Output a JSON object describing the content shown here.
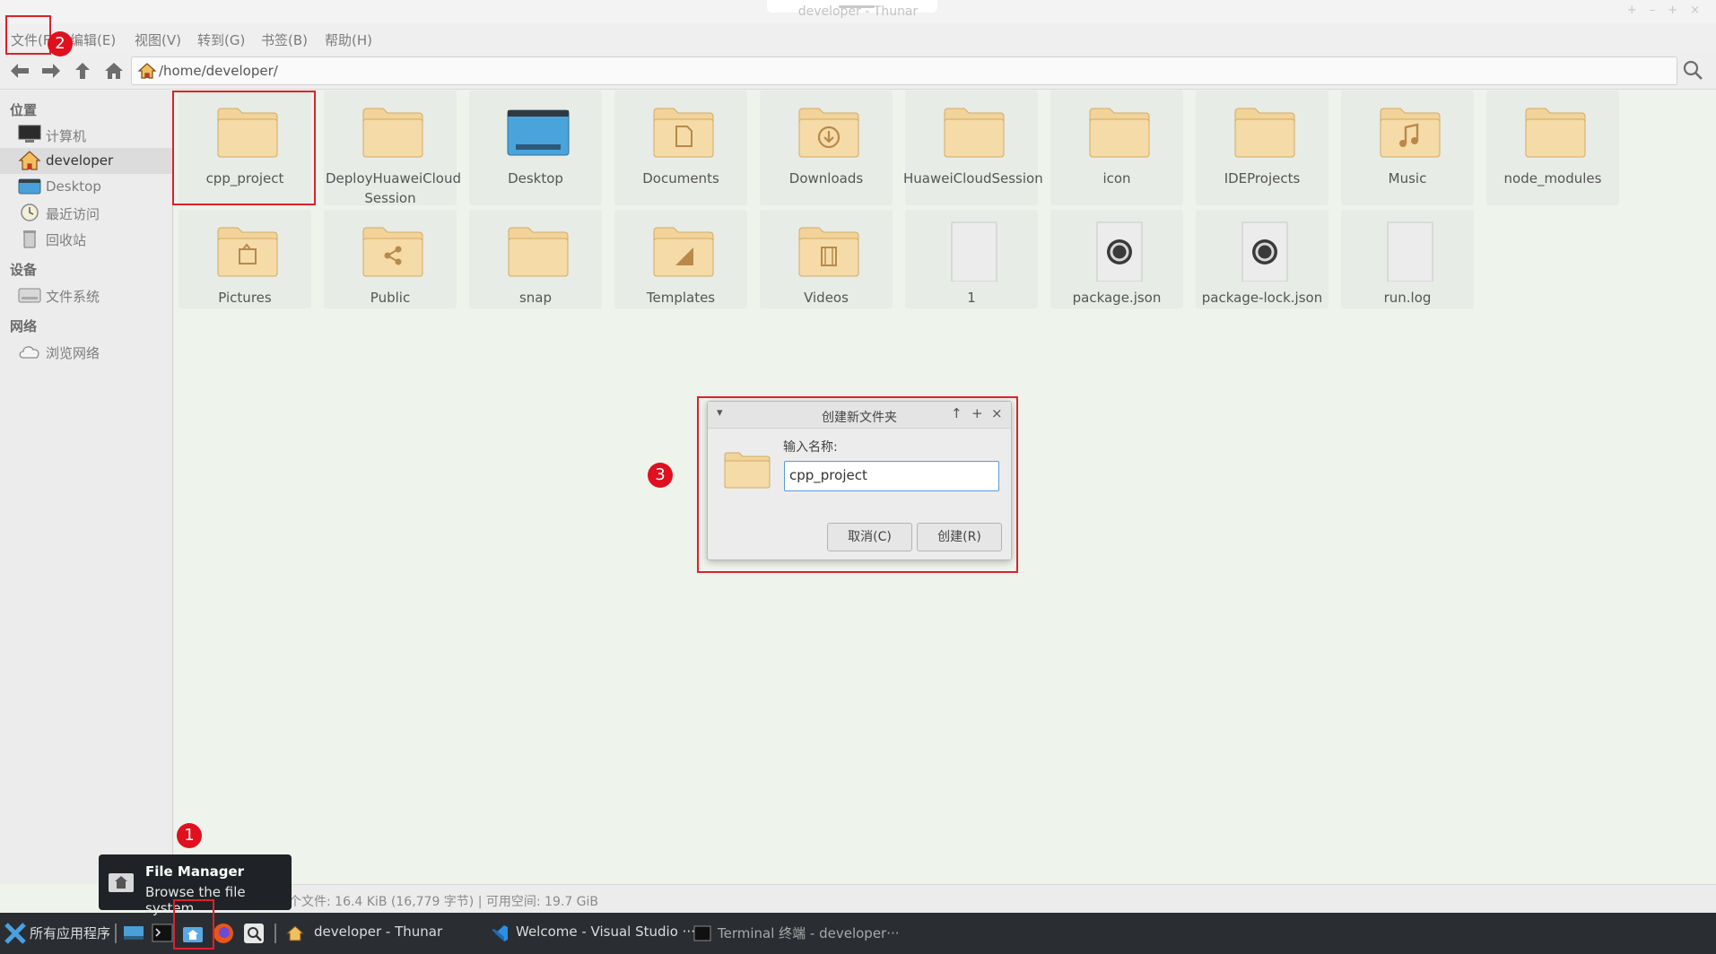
{
  "window": {
    "title": "developer - Thunar",
    "controls": [
      "+",
      "–",
      "+",
      "×"
    ]
  },
  "menubar": {
    "items": [
      "文件(F)",
      "编辑(E)",
      "视图(V)",
      "转到(G)",
      "书签(B)",
      "帮助(H)"
    ]
  },
  "toolbar": {
    "path": "/home/developer/"
  },
  "sidebar": {
    "sections": [
      {
        "title": "位置",
        "items": [
          {
            "label": "计算机",
            "icon": "computer-icon"
          },
          {
            "label": "developer",
            "icon": "home-icon"
          },
          {
            "label": "Desktop",
            "icon": "desktop-icon"
          },
          {
            "label": "最近访问",
            "icon": "recent-icon"
          },
          {
            "label": "回收站",
            "icon": "trash-icon"
          }
        ]
      },
      {
        "title": "设备",
        "items": [
          {
            "label": "文件系统",
            "icon": "drive-icon"
          }
        ]
      },
      {
        "title": "网络",
        "items": [
          {
            "label": "浏览网络",
            "icon": "network-icon"
          }
        ]
      }
    ]
  },
  "files": [
    {
      "name": "cpp_project",
      "type": "folder"
    },
    {
      "name": "DeployHuaweiCloud Session",
      "type": "folder"
    },
    {
      "name": "Desktop",
      "type": "desktop"
    },
    {
      "name": "Documents",
      "type": "folder-documents"
    },
    {
      "name": "Downloads",
      "type": "folder-downloads"
    },
    {
      "name": "HuaweiCloudSession",
      "type": "folder"
    },
    {
      "name": "icon",
      "type": "folder"
    },
    {
      "name": "IDEProjects",
      "type": "folder"
    },
    {
      "name": "Music",
      "type": "folder-music"
    },
    {
      "name": "node_modules",
      "type": "folder"
    },
    {
      "name": "Pictures",
      "type": "folder-pictures"
    },
    {
      "name": "Public",
      "type": "folder-public"
    },
    {
      "name": "snap",
      "type": "folder"
    },
    {
      "name": "Templates",
      "type": "folder-templates"
    },
    {
      "name": "Videos",
      "type": "folder-videos"
    },
    {
      "name": "1",
      "type": "file"
    },
    {
      "name": "package.json",
      "type": "json"
    },
    {
      "name": "package-lock.json",
      "type": "json"
    },
    {
      "name": "run.log",
      "type": "file"
    }
  ],
  "statusbar": {
    "text": "个文件: 16.4 KiB (16,779 字节)  |  可用空间: 19.7 GiB"
  },
  "tooltip": {
    "title": "File Manager",
    "subtitle": "Browse the file system"
  },
  "dialog": {
    "title": "创建新文件夹",
    "prompt": "输入名称:",
    "value": "cpp_project",
    "cancel_label": "取消(C)",
    "create_label": "创建(R)"
  },
  "taskbar": {
    "start_label": "所有应用程序",
    "tasks": [
      "developer - Thunar",
      "Welcome - Visual Studio ···",
      "Terminal 终端 - developer···"
    ]
  },
  "annotations": [
    "1",
    "2",
    "3"
  ],
  "colors": {
    "accent_red": "#e0202b",
    "folder": "#f2d39a",
    "taskbar": "#2a2e33"
  }
}
